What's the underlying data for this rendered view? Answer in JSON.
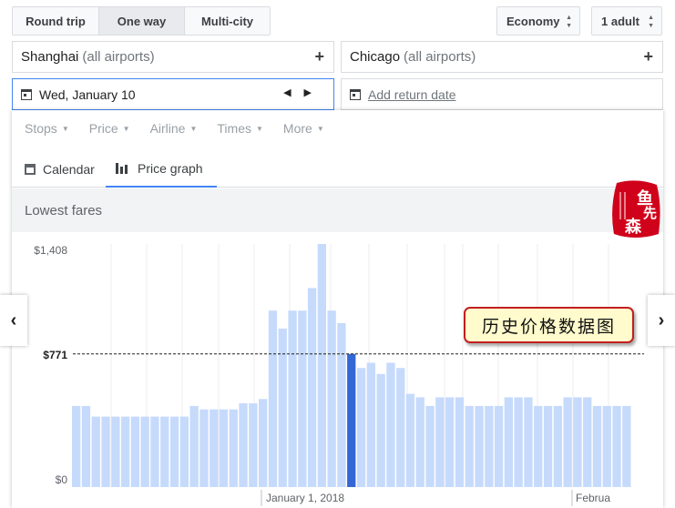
{
  "trip_types": [
    {
      "label": "Round trip",
      "active": false
    },
    {
      "label": "One way",
      "active": true
    },
    {
      "label": "Multi-city",
      "active": false
    }
  ],
  "cabin": "Economy",
  "passengers": "1 adult",
  "origin": {
    "city": "Shanghai",
    "qualifier": "(all airports)"
  },
  "destination": {
    "city": "Chicago",
    "qualifier": "(all airports)"
  },
  "depart_date": "Wed, January 10",
  "return_placeholder": "Add return date",
  "filters": [
    "Stops",
    "Price",
    "Airline",
    "Times",
    "More"
  ],
  "view_tabs": [
    {
      "label": "Calendar",
      "icon": "calendar-icon",
      "active": false
    },
    {
      "label": "Price graph",
      "icon": "bar-chart-icon",
      "active": true
    }
  ],
  "section_title": "Lowest fares",
  "annotation": "历史价格数据图",
  "stamp_text": "鱼先森",
  "colors": {
    "bar": "#c6dafc",
    "bar_selected": "#3367d6",
    "accent": "#4285f4",
    "annotation_border": "#c21f1f",
    "stamp": "#d0021b"
  },
  "chart_data": {
    "type": "bar",
    "y_tick_labels": [
      "$1,408",
      "$771",
      "$0"
    ],
    "x_tick_labels": [
      "January 1, 2018",
      "Februa"
    ],
    "ylim": [
      0,
      1408
    ],
    "reference_value": 771,
    "selected_index": 28,
    "values": [
      470,
      470,
      408,
      408,
      408,
      408,
      408,
      408,
      408,
      408,
      408,
      408,
      470,
      450,
      450,
      450,
      450,
      485,
      485,
      510,
      1022,
      918,
      1022,
      1022,
      1153,
      1408,
      1022,
      950,
      771,
      690,
      720,
      655,
      720,
      690,
      540,
      520,
      470,
      520,
      520,
      520,
      470,
      470,
      470,
      470,
      520,
      520,
      520,
      470,
      470,
      470,
      520,
      520,
      520,
      470,
      470,
      470,
      470
    ]
  }
}
